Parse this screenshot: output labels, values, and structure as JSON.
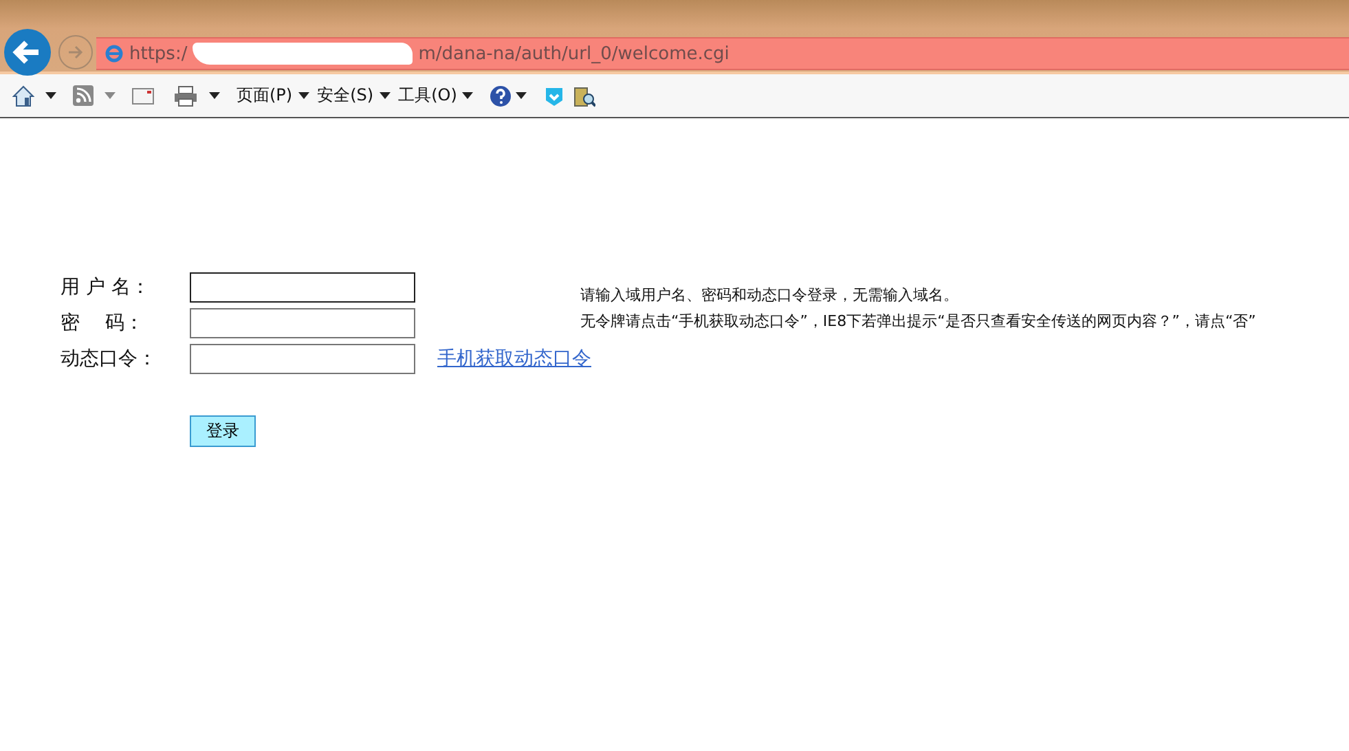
{
  "browser": {
    "url_start": "https:/",
    "url_end": "m/dana-na/auth/url_0/welcome.cgi"
  },
  "toolbar": {
    "menus": [
      {
        "label": "页面(P)"
      },
      {
        "label": "安全(S)"
      },
      {
        "label": "工具(O)"
      }
    ]
  },
  "form": {
    "fields": [
      {
        "label": "用 户 名："
      },
      {
        "label": "密　 码："
      },
      {
        "label": "动态口令："
      }
    ],
    "link": "手机获取动态口令",
    "submit": "登录"
  },
  "notes": [
    "请输入域用户名、密码和动态口令登录，无需输入域名。",
    "无令牌请点击“手机获取动态口令”，IE8下若弹出提示“是否只查看安全传送的网页内容？”，请点“否”"
  ]
}
